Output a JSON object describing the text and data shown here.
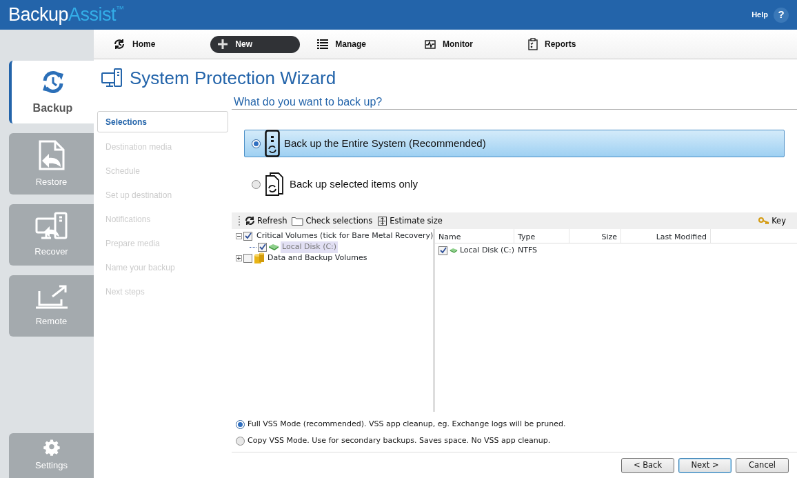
{
  "header": {
    "logo_main": "Backup",
    "logo_accent": "Assist",
    "logo_mark": "™",
    "help": "Help",
    "help_icon": "?"
  },
  "sidebar": {
    "items": [
      {
        "label": "Backup",
        "kind": "backup",
        "selected": true
      },
      {
        "label": "Restore",
        "kind": "restore",
        "selected": false
      },
      {
        "label": "Recover",
        "kind": "recover",
        "selected": false
      },
      {
        "label": "Remote",
        "kind": "remote",
        "selected": false
      }
    ],
    "settings": {
      "label": "Settings",
      "selected": false
    }
  },
  "toolbar": [
    {
      "label": "Home",
      "kind": "home",
      "selected": false
    },
    {
      "label": "New",
      "kind": "new",
      "selected": true
    },
    {
      "label": "Manage",
      "kind": "manage",
      "selected": false
    },
    {
      "label": "Monitor",
      "kind": "monitor",
      "selected": false
    },
    {
      "label": "Reports",
      "kind": "reports",
      "selected": false
    }
  ],
  "wizard": {
    "title": "System Protection Wizard",
    "question": "What do you want to back up?"
  },
  "steps": [
    {
      "label": "Selections",
      "selected": true,
      "disabled": false
    },
    {
      "label": "Destination media",
      "selected": false,
      "disabled": true
    },
    {
      "label": "Schedule",
      "selected": false,
      "disabled": true
    },
    {
      "label": "Set up destination",
      "selected": false,
      "disabled": true
    },
    {
      "label": "Notifications",
      "selected": false,
      "disabled": true
    },
    {
      "label": "Prepare media",
      "selected": false,
      "disabled": true
    },
    {
      "label": "Name your backup",
      "selected": false,
      "disabled": true
    },
    {
      "label": "Next steps",
      "selected": false,
      "disabled": true
    }
  ],
  "backup_options": [
    {
      "label": "Back up the Entire System (Recommended)",
      "kind": "system",
      "selected": true
    },
    {
      "label": "Back up selected items only",
      "kind": "items",
      "selected": false
    }
  ],
  "selection_toolbar": {
    "actions": [
      {
        "label": "Refresh",
        "kind": "refresh"
      },
      {
        "label": "Check selections",
        "kind": "check"
      },
      {
        "label": "Estimate size",
        "kind": "estimate"
      }
    ],
    "key": "Key"
  },
  "tree": [
    {
      "label": "Critical Volumes (tick for Bare Metal Recovery)",
      "kind": "server",
      "checked": true,
      "expanded": true,
      "selected": false,
      "children": [
        {
          "label": "Local Disk (C:)",
          "kind": "disk",
          "checked": true,
          "selected": true
        }
      ]
    },
    {
      "label": "Data and Backup Volumes",
      "kind": "volumes",
      "checked": false,
      "expanded": false,
      "selected": false
    }
  ],
  "table": {
    "columns": [
      "Name",
      "Type",
      "Size",
      "Last Modified"
    ],
    "rows": [
      {
        "name": "Local Disk (C:)",
        "type": "NTFS",
        "checked": true
      }
    ]
  },
  "vss_modes": [
    {
      "label": "Full VSS Mode (recommended). VSS app cleanup, eg. Exchange logs will be pruned.",
      "selected": true
    },
    {
      "label": "Copy VSS Mode. Use for secondary backups. Saves space. No VSS app cleanup.",
      "selected": false
    }
  ],
  "buttons": [
    {
      "label": "< Back",
      "kind": "back"
    },
    {
      "label": "Next >",
      "kind": "next"
    },
    {
      "label": "Cancel",
      "kind": "cancel"
    }
  ]
}
